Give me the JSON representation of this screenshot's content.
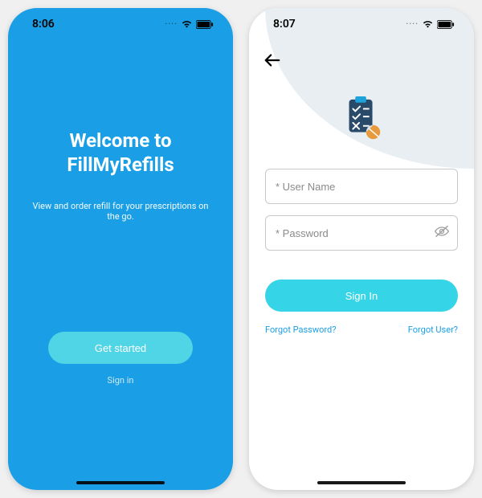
{
  "left": {
    "time": "8:06",
    "title_line1": "Welcome to",
    "title_line2": "FillMyRefills",
    "subtitle": "View and order refill for your prescriptions on the go.",
    "get_started_label": "Get started",
    "signin_link": "Sign in"
  },
  "right": {
    "time": "8:07",
    "username_placeholder": "* User Name",
    "password_placeholder": "* Password",
    "signin_button": "Sign In",
    "forgot_password": "Forgot Password?",
    "forgot_user": "Forgot User?"
  },
  "colors": {
    "brand_blue": "#1a9fe6",
    "accent_cyan": "#35d4e7"
  }
}
